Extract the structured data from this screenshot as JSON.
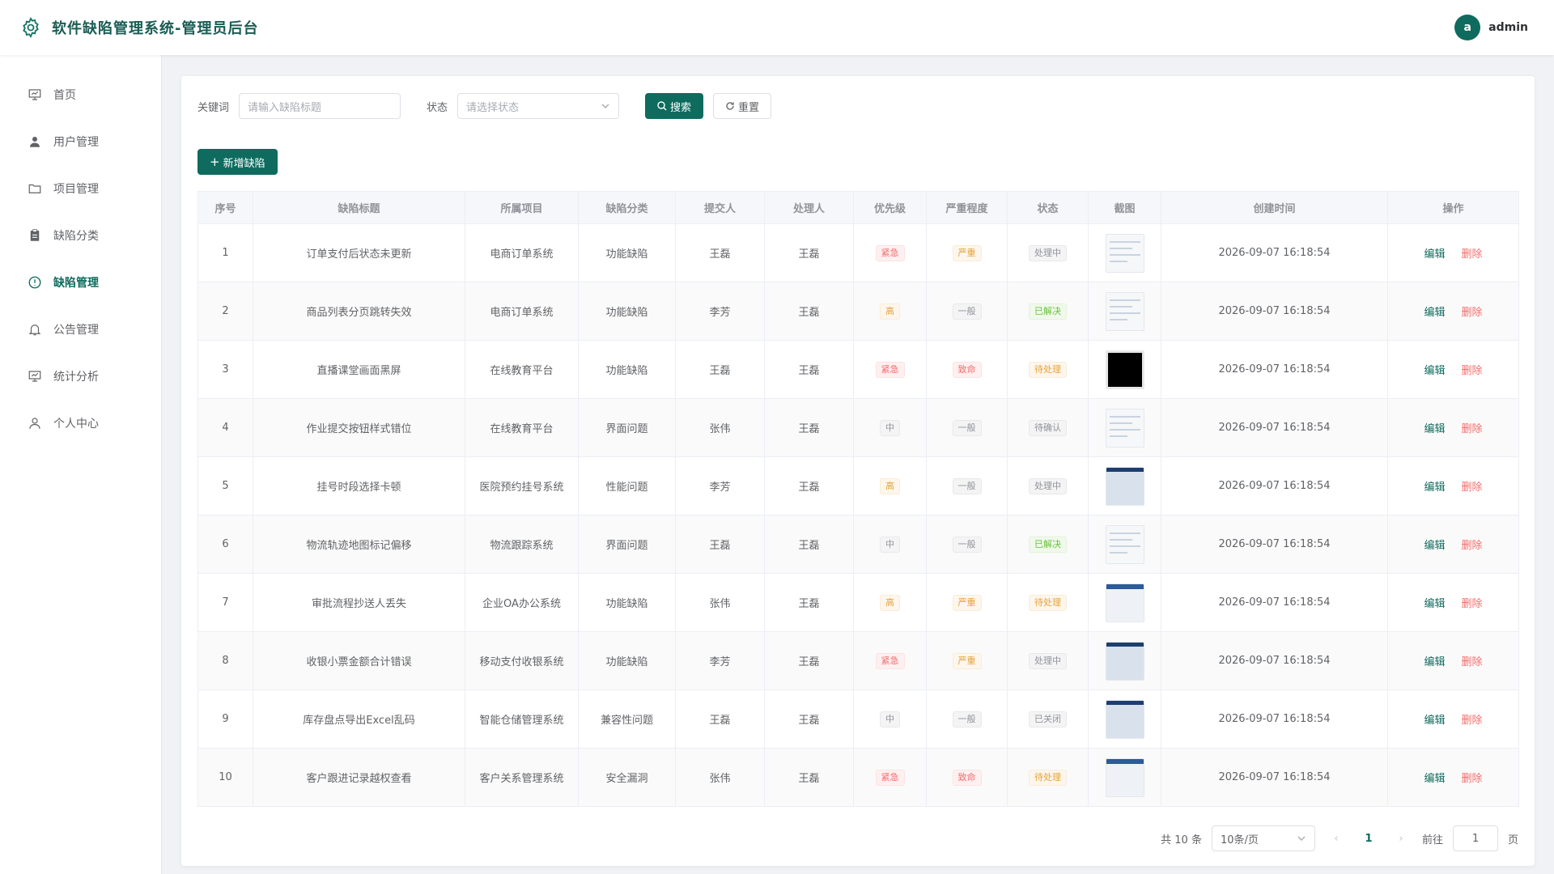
{
  "app": {
    "title": "软件缺陷管理系统-管理员后台"
  },
  "user": {
    "avatar_letter": "a",
    "name": "admin"
  },
  "sidebar": {
    "items": [
      {
        "label": "首页",
        "icon": "monitor-icon"
      },
      {
        "label": "用户管理",
        "icon": "user-icon"
      },
      {
        "label": "项目管理",
        "icon": "folder-icon"
      },
      {
        "label": "缺陷分类",
        "icon": "clipboard-icon"
      },
      {
        "label": "缺陷管理",
        "icon": "warning-icon",
        "active": true
      },
      {
        "label": "公告管理",
        "icon": "bell-icon"
      },
      {
        "label": "统计分析",
        "icon": "chart-icon"
      },
      {
        "label": "个人中心",
        "icon": "person-icon"
      }
    ]
  },
  "filters": {
    "keyword_label": "关键词",
    "keyword_placeholder": "请输入缺陷标题",
    "status_label": "状态",
    "status_placeholder": "请选择状态",
    "search_label": "搜索",
    "reset_label": "重置"
  },
  "actions": {
    "add_label": "新增缺陷"
  },
  "table": {
    "columns": [
      "序号",
      "缺陷标题",
      "所属项目",
      "缺陷分类",
      "提交人",
      "处理人",
      "优先级",
      "严重程度",
      "状态",
      "截图",
      "创建时间",
      "操作"
    ],
    "edit_label": "编辑",
    "delete_label": "删除",
    "rows": [
      {
        "no": "1",
        "title": "订单支付后状态未更新",
        "project": "电商订单系统",
        "category": "功能缺陷",
        "submitter": "王磊",
        "handler": "王磊",
        "priority": "紧急",
        "severity": "严重",
        "status": "处理中",
        "created": "2026-09-07 16:18:54",
        "p_color": "red",
        "s_color": "orange",
        "st_color": "gray",
        "thumb": "light"
      },
      {
        "no": "2",
        "title": "商品列表分页跳转失效",
        "project": "电商订单系统",
        "category": "功能缺陷",
        "submitter": "李芳",
        "handler": "王磊",
        "priority": "高",
        "severity": "一般",
        "status": "已解决",
        "created": "2026-09-07 16:18:54",
        "p_color": "orange",
        "s_color": "gray",
        "st_color": "green",
        "thumb": "light"
      },
      {
        "no": "3",
        "title": "直播课堂画面黑屏",
        "project": "在线教育平台",
        "category": "功能缺陷",
        "submitter": "王磊",
        "handler": "王磊",
        "priority": "紧急",
        "severity": "致命",
        "status": "待处理",
        "created": "2026-09-07 16:18:54",
        "p_color": "red",
        "s_color": "red",
        "st_color": "orange",
        "thumb": "dark"
      },
      {
        "no": "4",
        "title": "作业提交按钮样式错位",
        "project": "在线教育平台",
        "category": "界面问题",
        "submitter": "张伟",
        "handler": "王磊",
        "priority": "中",
        "severity": "一般",
        "status": "待确认",
        "created": "2026-09-07 16:18:54",
        "p_color": "gray",
        "s_color": "gray",
        "st_color": "gray",
        "thumb": "light"
      },
      {
        "no": "5",
        "title": "挂号时段选择卡顿",
        "project": "医院预约挂号系统",
        "category": "性能问题",
        "submitter": "李芳",
        "handler": "王磊",
        "priority": "高",
        "severity": "一般",
        "status": "处理中",
        "created": "2026-09-07 16:18:54",
        "p_color": "orange",
        "s_color": "gray",
        "st_color": "gray",
        "thumb": "screen"
      },
      {
        "no": "6",
        "title": "物流轨迹地图标记偏移",
        "project": "物流跟踪系统",
        "category": "界面问题",
        "submitter": "王磊",
        "handler": "王磊",
        "priority": "中",
        "severity": "一般",
        "status": "已解决",
        "created": "2026-09-07 16:18:54",
        "p_color": "gray",
        "s_color": "gray",
        "st_color": "green",
        "thumb": "light"
      },
      {
        "no": "7",
        "title": "审批流程抄送人丢失",
        "project": "企业OA办公系统",
        "category": "功能缺陷",
        "submitter": "张伟",
        "handler": "王磊",
        "priority": "高",
        "severity": "严重",
        "status": "待处理",
        "created": "2026-09-07 16:18:54",
        "p_color": "orange",
        "s_color": "orange",
        "st_color": "orange",
        "thumb": "blue"
      },
      {
        "no": "8",
        "title": "收银小票金额合计错误",
        "project": "移动支付收银系统",
        "category": "功能缺陷",
        "submitter": "李芳",
        "handler": "王磊",
        "priority": "紧急",
        "severity": "严重",
        "status": "处理中",
        "created": "2026-09-07 16:18:54",
        "p_color": "red",
        "s_color": "orange",
        "st_color": "gray",
        "thumb": "screen"
      },
      {
        "no": "9",
        "title": "库存盘点导出Excel乱码",
        "project": "智能仓储管理系统",
        "category": "兼容性问题",
        "submitter": "王磊",
        "handler": "王磊",
        "priority": "中",
        "severity": "一般",
        "status": "已关闭",
        "created": "2026-09-07 16:18:54",
        "p_color": "gray",
        "s_color": "gray",
        "st_color": "gray",
        "thumb": "screen"
      },
      {
        "no": "10",
        "title": "客户跟进记录越权查看",
        "project": "客户关系管理系统",
        "category": "安全漏洞",
        "submitter": "张伟",
        "handler": "王磊",
        "priority": "紧急",
        "severity": "致命",
        "status": "待处理",
        "created": "2026-09-07 16:18:54",
        "p_color": "red",
        "s_color": "red",
        "st_color": "orange",
        "thumb": "blue"
      }
    ]
  },
  "pagination": {
    "total_text": "共 10 条",
    "page_size": "10条/页",
    "current_page": "1",
    "goto_label": "前往",
    "goto_value": "1",
    "page_suffix": "页"
  },
  "colors": {
    "primary": "#0e6b5e",
    "danger": "#f56c6c",
    "warning": "#e6a23c",
    "success": "#67c23a"
  }
}
